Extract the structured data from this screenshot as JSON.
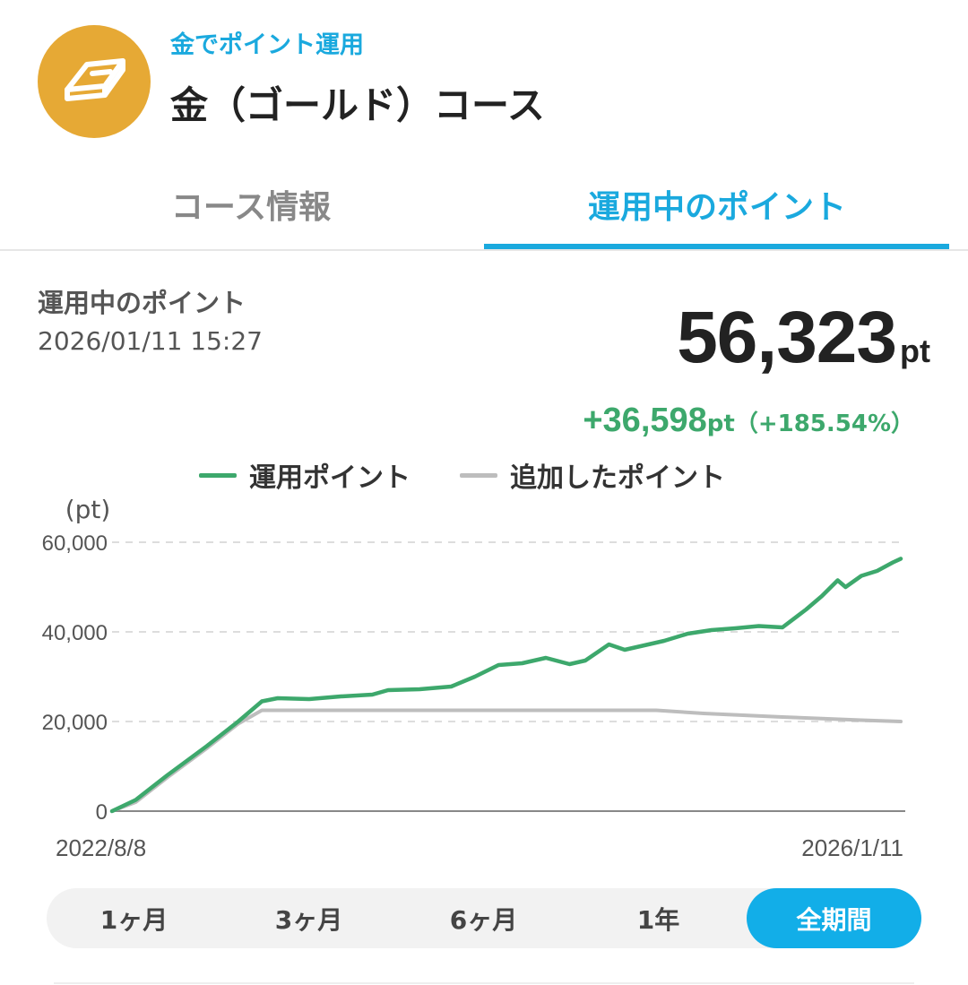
{
  "header": {
    "subtitle": "金でポイント運用",
    "title": "金（ゴールド）コース",
    "icon": "gold-bar-icon",
    "badge_color": "#E6A935"
  },
  "tabs": [
    {
      "label": "コース情報",
      "active": false
    },
    {
      "label": "運用中のポイント",
      "active": true
    }
  ],
  "summary": {
    "label": "運用中のポイント",
    "datetime": "2026/01/11 15:27",
    "total": "56,323",
    "total_unit": "pt",
    "change": "+36,598",
    "change_unit": "pt",
    "change_pct": "（+185.54%）",
    "change_color": "#3DA86C"
  },
  "legend": [
    {
      "label": "運用ポイント",
      "color": "#3DA86C"
    },
    {
      "label": "追加したポイント",
      "color": "#BDBDBD"
    }
  ],
  "chart_data": {
    "type": "line",
    "ylabel": "(pt)",
    "ylim": [
      0,
      60000
    ],
    "yticks": [
      "60,000",
      "40,000",
      "20,000",
      "0"
    ],
    "ytick_values": [
      60000,
      40000,
      20000,
      0
    ],
    "x_start_label": "2022/8/8",
    "x_end_label": "2026/1/11",
    "x_range": [
      0,
      1
    ],
    "grid": "horizontal dashed",
    "series": [
      {
        "name": "運用ポイント",
        "color": "#3DA86C",
        "x": [
          0,
          0.03,
          0.07,
          0.12,
          0.16,
          0.19,
          0.21,
          0.25,
          0.29,
          0.33,
          0.35,
          0.39,
          0.43,
          0.46,
          0.49,
          0.52,
          0.55,
          0.58,
          0.6,
          0.63,
          0.65,
          0.68,
          0.7,
          0.73,
          0.76,
          0.79,
          0.82,
          0.85,
          0.88,
          0.9,
          0.92,
          0.93,
          0.95,
          0.97,
          0.99,
          1.0
        ],
        "y": [
          0,
          2500,
          8000,
          14500,
          20000,
          24500,
          25200,
          25000,
          25600,
          26000,
          27000,
          27200,
          27800,
          30000,
          32600,
          33000,
          34200,
          32800,
          33600,
          37200,
          36000,
          37200,
          38000,
          39600,
          40400,
          40800,
          41300,
          41000,
          45000,
          48000,
          51500,
          50000,
          52500,
          53600,
          55500,
          56323
        ]
      },
      {
        "name": "追加したポイント",
        "color": "#BDBDBD",
        "x": [
          0,
          0.03,
          0.07,
          0.12,
          0.16,
          0.19,
          0.69,
          0.75,
          0.85,
          0.95,
          1.0
        ],
        "y": [
          0,
          2000,
          7500,
          14000,
          19500,
          22500,
          22500,
          21800,
          21000,
          20300,
          20000
        ]
      }
    ]
  },
  "periods": [
    {
      "label": "1ヶ月",
      "active": false
    },
    {
      "label": "3ヶ月",
      "active": false
    },
    {
      "label": "6ヶ月",
      "active": false
    },
    {
      "label": "1年",
      "active": false
    },
    {
      "label": "全期間",
      "active": true
    }
  ],
  "accent": "#1AA9DE"
}
